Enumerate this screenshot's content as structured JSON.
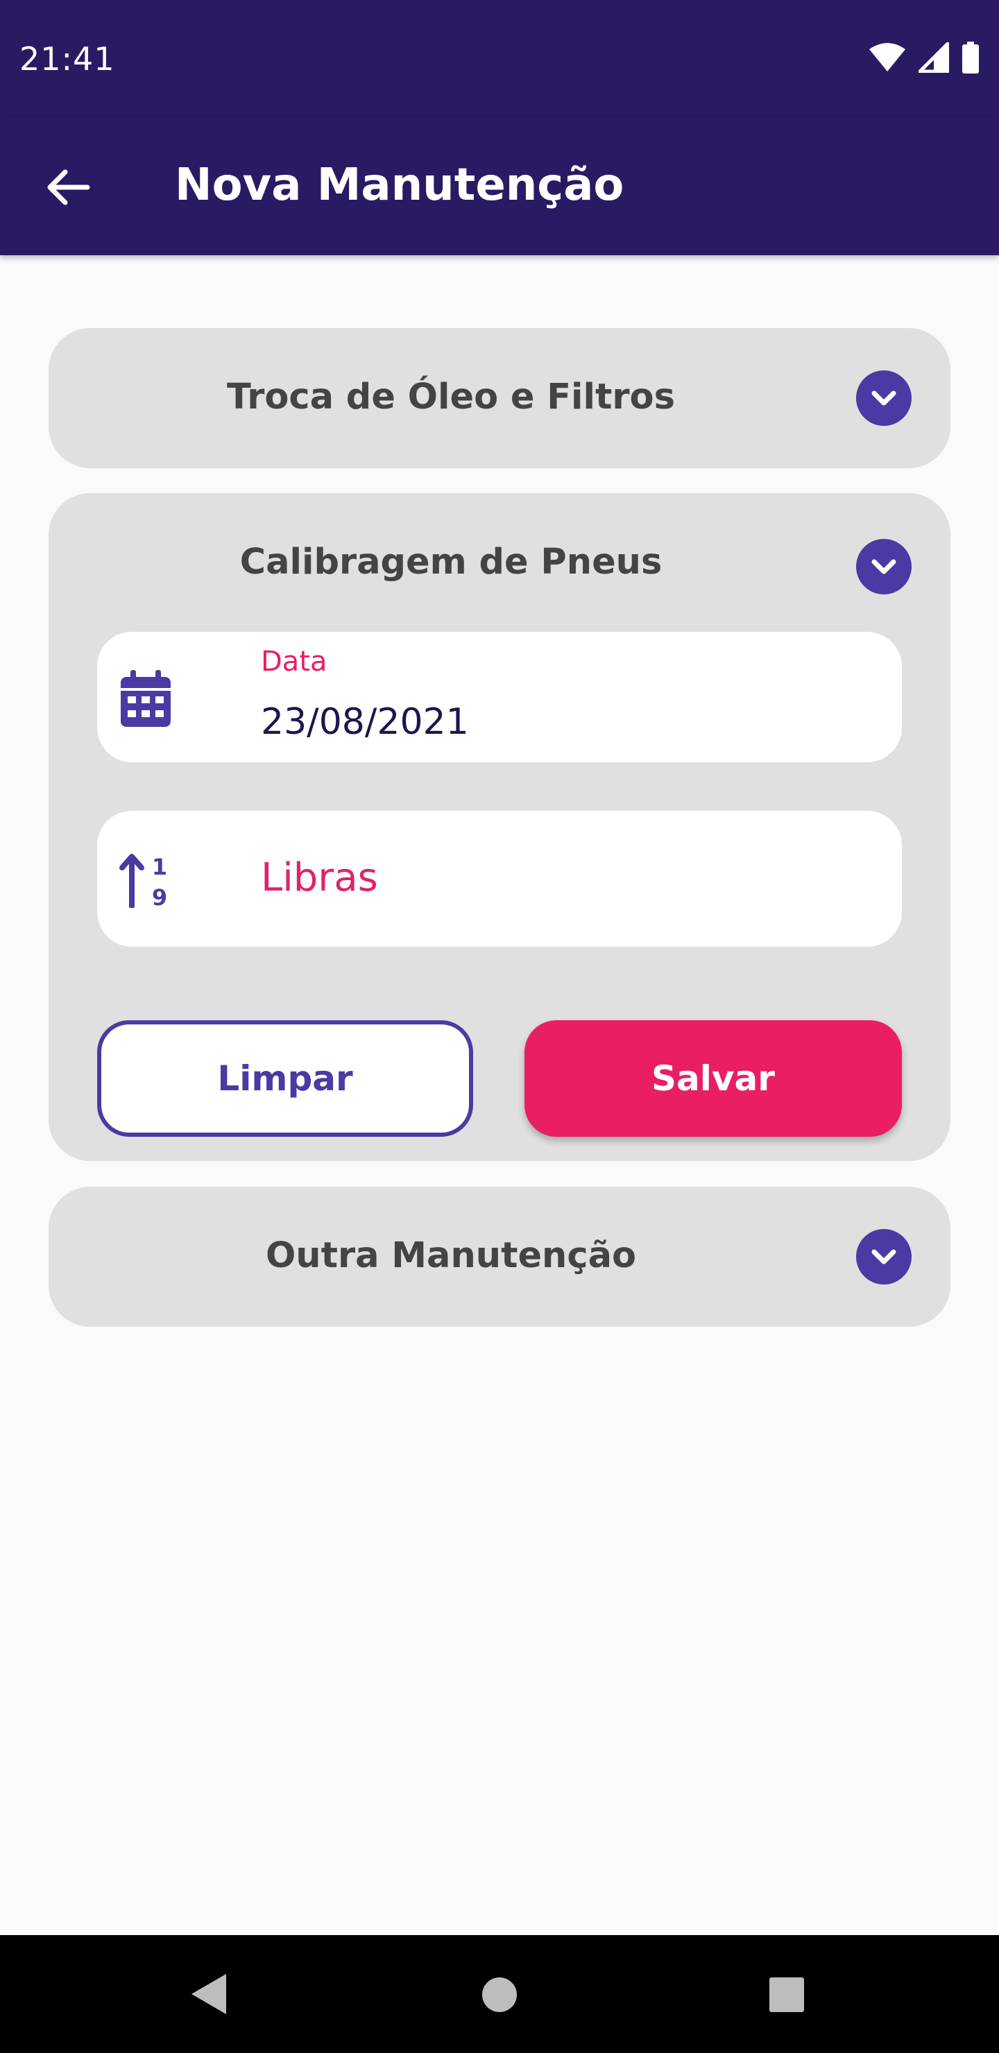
{
  "status_bar": {
    "time": "21:41"
  },
  "app_bar": {
    "title": "Nova Manutenção"
  },
  "sections": [
    {
      "title": "Troca de Óleo e Filtros",
      "expanded": false
    },
    {
      "title": "Calibragem de Pneus",
      "expanded": true,
      "date_field": {
        "label": "Data",
        "value": "23/08/2021"
      },
      "pressure_field": {
        "placeholder": "Libras"
      },
      "clear_button": "Limpar",
      "save_button": "Salvar"
    },
    {
      "title": "Outra Manutenção",
      "expanded": false
    }
  ],
  "colors": {
    "app_bar": "#2a1a64",
    "accent": "#4a3aa4",
    "primary_button": "#e91e63",
    "card_background": "#e0e0e0"
  }
}
